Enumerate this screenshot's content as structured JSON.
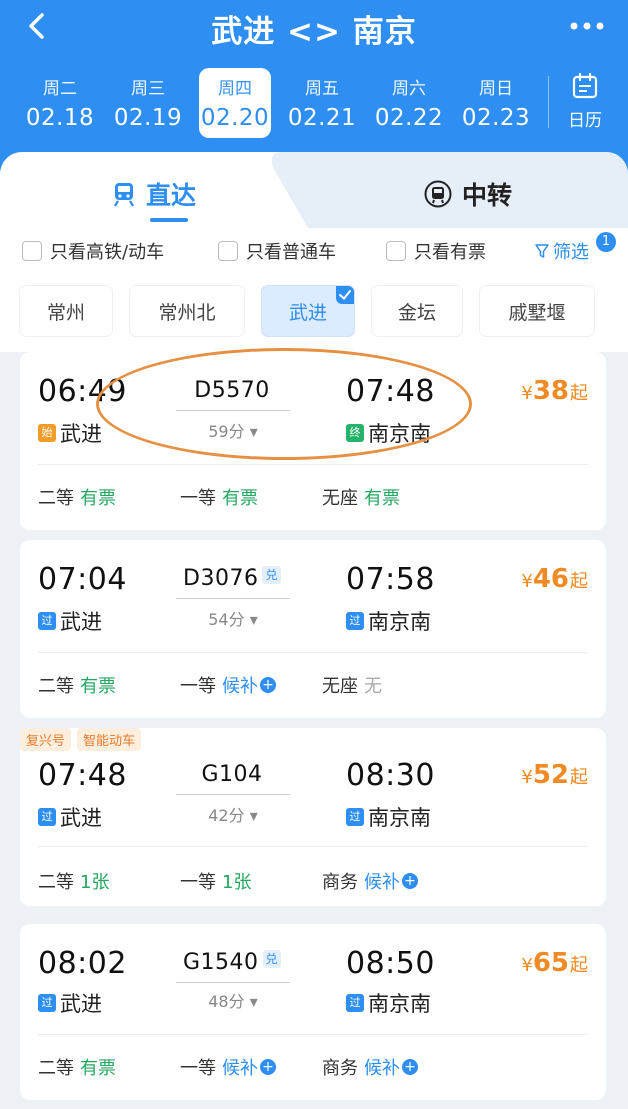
{
  "header": {
    "title": "武进 <> 南京",
    "calendar_label": "日历"
  },
  "dates": [
    {
      "weekday": "周二",
      "date": "02.18"
    },
    {
      "weekday": "周三",
      "date": "02.19"
    },
    {
      "weekday": "周四",
      "date": "02.20"
    },
    {
      "weekday": "周五",
      "date": "02.21"
    },
    {
      "weekday": "周六",
      "date": "02.22"
    },
    {
      "weekday": "周日",
      "date": "02.23"
    }
  ],
  "selected_date_index": 2,
  "tabs": {
    "direct": "直达",
    "transfer": "中转"
  },
  "filters": {
    "highspeed_only": "只看高铁/动车",
    "normal_only": "只看普通车",
    "available_only": "只看有票",
    "filter_label": "筛选",
    "filter_count": "1"
  },
  "stations": [
    "常州",
    "常州北",
    "武进",
    "金坛",
    "戚墅堰"
  ],
  "selected_station_index": 2,
  "trains": [
    {
      "tags": [],
      "dep_time": "06:49",
      "dep_station": "武进",
      "dep_badge": "始",
      "train_no": "D5570",
      "dui": "",
      "duration": "59分",
      "arr_time": "07:48",
      "arr_station": "南京南",
      "arr_badge": "终",
      "price_symbol": "¥",
      "price": "38",
      "price_suffix": "起",
      "seats": [
        {
          "cls": "二等",
          "status": "有票",
          "tone": "green"
        },
        {
          "cls": "一等",
          "status": "有票",
          "tone": "green"
        },
        {
          "cls": "无座",
          "status": "有票",
          "tone": "green"
        }
      ]
    },
    {
      "tags": [],
      "dep_time": "07:04",
      "dep_station": "武进",
      "dep_badge": "过",
      "train_no": "D3076",
      "dui": "兑",
      "duration": "54分",
      "arr_time": "07:58",
      "arr_station": "南京南",
      "arr_badge": "过",
      "price_symbol": "¥",
      "price": "46",
      "price_suffix": "起",
      "seats": [
        {
          "cls": "二等",
          "status": "有票",
          "tone": "green"
        },
        {
          "cls": "一等",
          "status": "候补",
          "tone": "blue",
          "plus": "+"
        },
        {
          "cls": "无座",
          "status": "无",
          "tone": "gray"
        }
      ]
    },
    {
      "tags": [
        "复兴号",
        "智能动车"
      ],
      "dep_time": "07:48",
      "dep_station": "武进",
      "dep_badge": "过",
      "train_no": "G104",
      "dui": "",
      "duration": "42分",
      "arr_time": "08:30",
      "arr_station": "南京南",
      "arr_badge": "过",
      "price_symbol": "¥",
      "price": "52",
      "price_suffix": "起",
      "seats": [
        {
          "cls": "二等",
          "status": "1张",
          "tone": "green"
        },
        {
          "cls": "一等",
          "status": "1张",
          "tone": "green"
        },
        {
          "cls": "商务",
          "status": "候补",
          "tone": "blue",
          "plus": "+"
        }
      ]
    },
    {
      "tags": [],
      "dep_time": "08:02",
      "dep_station": "武进",
      "dep_badge": "过",
      "train_no": "G1540",
      "dui": "兑",
      "duration": "48分",
      "arr_time": "08:50",
      "arr_station": "南京南",
      "arr_badge": "过",
      "price_symbol": "¥",
      "price": "65",
      "price_suffix": "起",
      "seats": [
        {
          "cls": "二等",
          "status": "有票",
          "tone": "green"
        },
        {
          "cls": "一等",
          "status": "候补",
          "tone": "blue",
          "plus": "+"
        },
        {
          "cls": "商务",
          "status": "候补",
          "tone": "blue",
          "plus": "+"
        }
      ]
    }
  ],
  "colors": {
    "primary": "#2e8ef2",
    "price": "#f08a24",
    "available": "#24a760",
    "highlight_ring": "#e69043"
  },
  "icons": {
    "back": "back-arrow-icon",
    "more": "more-dots-icon",
    "calendar": "calendar-icon",
    "direct": "train-icon",
    "transfer": "transfer-bus-icon",
    "filter": "funnel-icon"
  }
}
